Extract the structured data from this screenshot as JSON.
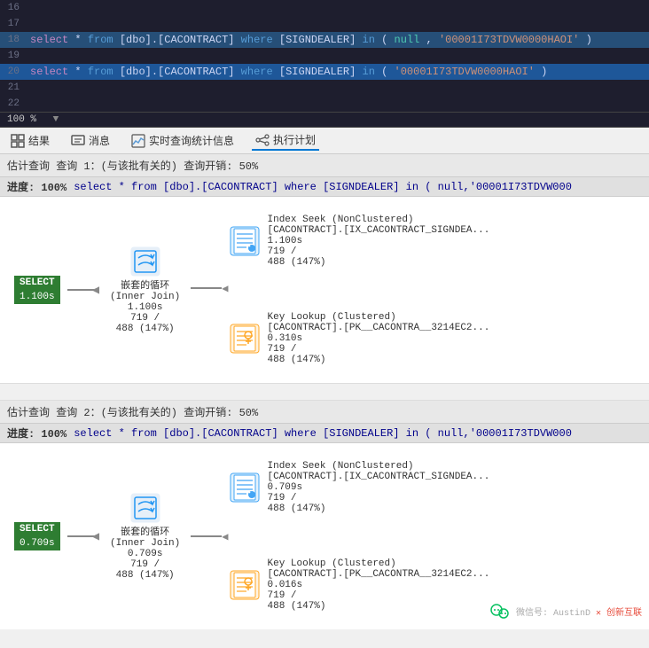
{
  "editor": {
    "lines": [
      {
        "num": "16",
        "content": "",
        "highlight": ""
      },
      {
        "num": "17",
        "content": "",
        "highlight": ""
      },
      {
        "num": "18",
        "content": "select * from [dbo].[CACONTRACT] where    [SIGNDEALER] in  ( null,'00001I73TDVW0000HAOI')",
        "highlight": "blue"
      },
      {
        "num": "19",
        "content": "",
        "highlight": ""
      },
      {
        "num": "20",
        "content": "select * from [dbo].[CACONTRACT] where    [SIGNDEALER] in  ( '00001I73TDVW0000HAOI')",
        "highlight": "blue2"
      },
      {
        "num": "21",
        "content": "",
        "highlight": ""
      },
      {
        "num": "22",
        "content": "",
        "highlight": ""
      }
    ],
    "zoom": "100 %"
  },
  "toolbar": {
    "items": [
      {
        "id": "results",
        "icon": "grid-icon",
        "label": "结果"
      },
      {
        "id": "messages",
        "icon": "message-icon",
        "label": "消息"
      },
      {
        "id": "realtime",
        "icon": "stats-icon",
        "label": "实时查询统计信息"
      },
      {
        "id": "execution-plan",
        "icon": "plan-icon",
        "label": "执行计划"
      }
    ]
  },
  "query1": {
    "info": "估计查询  查询 1：(与该批有关的) 查询开销: 50%",
    "progress_label": "进度: 100%",
    "progress_sql": "select * from [dbo].[CACONTRACT] where [SIGNDEALER] in ( null,'00001I73TDVW000",
    "select_node": {
      "label": "SELECT",
      "time": "1.100s"
    },
    "nested_loop": {
      "title": "嵌套的循环",
      "subtitle": "(Inner Join)",
      "time": "1.100s",
      "rows": "719 /",
      "actual": "488 (147%)"
    },
    "index_seek": {
      "title": "Index Seek (NonClustered)",
      "subtitle": "[CACONTRACT].[IX_CACONTRACT_SIGNDEA...",
      "time": "1.100s",
      "rows": "719 /",
      "actual": "488 (147%)"
    },
    "key_lookup": {
      "title": "Key Lookup (Clustered)",
      "subtitle": "[CACONTRACT].[PK__CACONTRA__3214EC2...",
      "time": "0.310s",
      "rows": "719 /",
      "actual": "488 (147%)"
    }
  },
  "query2": {
    "info": "估计查询  查询 2：(与该批有关的) 查询开销: 50%",
    "progress_label": "进度: 100%",
    "progress_sql": "select * from [dbo].[CACONTRACT] where [SIGNDEALER] in ( null,'00001I73TDVW000",
    "select_node": {
      "label": "SELECT",
      "time": "0.709s"
    },
    "nested_loop": {
      "title": "嵌套的循环",
      "subtitle": "(Inner Join)",
      "time": "0.709s",
      "rows": "719 /",
      "actual": "488 (147%)"
    },
    "index_seek": {
      "title": "Index Seek (NonClustered)",
      "subtitle": "[CACONTRACT].[IX_CACONTRACT_SIGNDEA...",
      "time": "0.709s",
      "rows": "719 /",
      "actual": "488 (147%)"
    },
    "key_lookup": {
      "title": "Key Lookup (Clustered)",
      "subtitle": "[CACONTRACT].[PK__CACONTRA__3214EC2...",
      "time": "0.016s",
      "rows": "719 /",
      "actual": "488 (147%)"
    }
  },
  "watermark": {
    "wechat": "微信号: AustinD",
    "company": "✕ 创新互联"
  }
}
